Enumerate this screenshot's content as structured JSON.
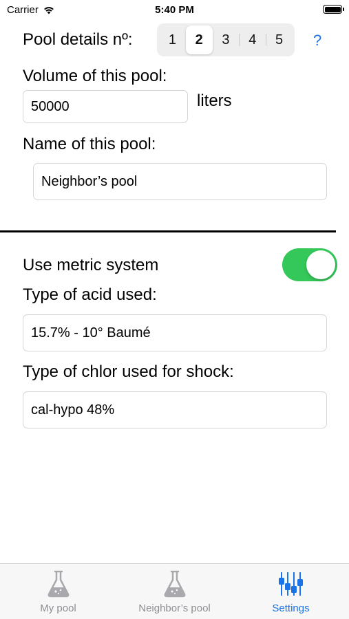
{
  "status": {
    "carrier": "Carrier",
    "time": "5:40 PM"
  },
  "pool": {
    "details_label": "Pool details nº:",
    "numbers": [
      "1",
      "2",
      "3",
      "4",
      "5"
    ],
    "selected": "2",
    "help": "?",
    "volume_label": "Volume of this pool:",
    "volume_value": "50000",
    "volume_unit": "liters",
    "name_label": "Name of this pool:",
    "name_value": "Neighbor’s pool"
  },
  "settings": {
    "metric_label": "Use metric system",
    "metric_on": true,
    "acid_label": "Type of acid used:",
    "acid_value": "15.7% - 10° Baumé",
    "chlor_label": "Type of chlor used for shock:",
    "chlor_value": "cal-hypo 48%"
  },
  "tabs": [
    {
      "label": "My pool",
      "icon": "flask-icon"
    },
    {
      "label": "Neighbor’s pool",
      "icon": "flask-icon"
    },
    {
      "label": "Settings",
      "icon": "sliders-icon"
    }
  ],
  "colors": {
    "accent": "#1a73e8",
    "toggle_on": "#34c759",
    "inactive_tab": "#8e8e93"
  }
}
